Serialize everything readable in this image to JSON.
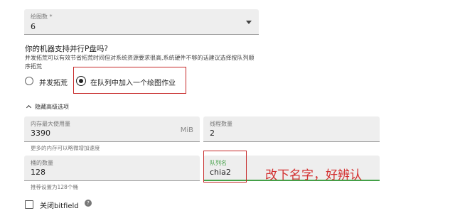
{
  "draw_count": {
    "label": "绘图数 *",
    "value": "6"
  },
  "parallel": {
    "question": "你的机器支持并行P盘吗?",
    "description": "并发拓荒可以有效节省拓荒时间但对系统资源要求很高,系统硬件不够的话建议选择按队列顺序拓荒",
    "options": [
      {
        "label": "并发拓荒",
        "selected": false
      },
      {
        "label": "在队列中加入一个绘图作业",
        "selected": true
      }
    ]
  },
  "advanced": {
    "toggle_label": "隐藏高级选项"
  },
  "memory": {
    "label": "内存最大使用量",
    "value": "3390",
    "unit": "MiB",
    "helper": "更多的内存可以略微增加速度"
  },
  "threads": {
    "label": "线程数量",
    "value": "2"
  },
  "buckets": {
    "label": "桶的数量",
    "value": "128",
    "helper": "推荐设置为128个桶"
  },
  "queue": {
    "label": "队列名",
    "value": "chia2"
  },
  "bitfield": {
    "label": "关闭bitfield",
    "checked": false
  },
  "annotation_text": "改下名字，好辨认",
  "colors": {
    "highlight_box": "#c62828",
    "annotation": "#d32f2f",
    "field_bg": "#eeeeee"
  }
}
